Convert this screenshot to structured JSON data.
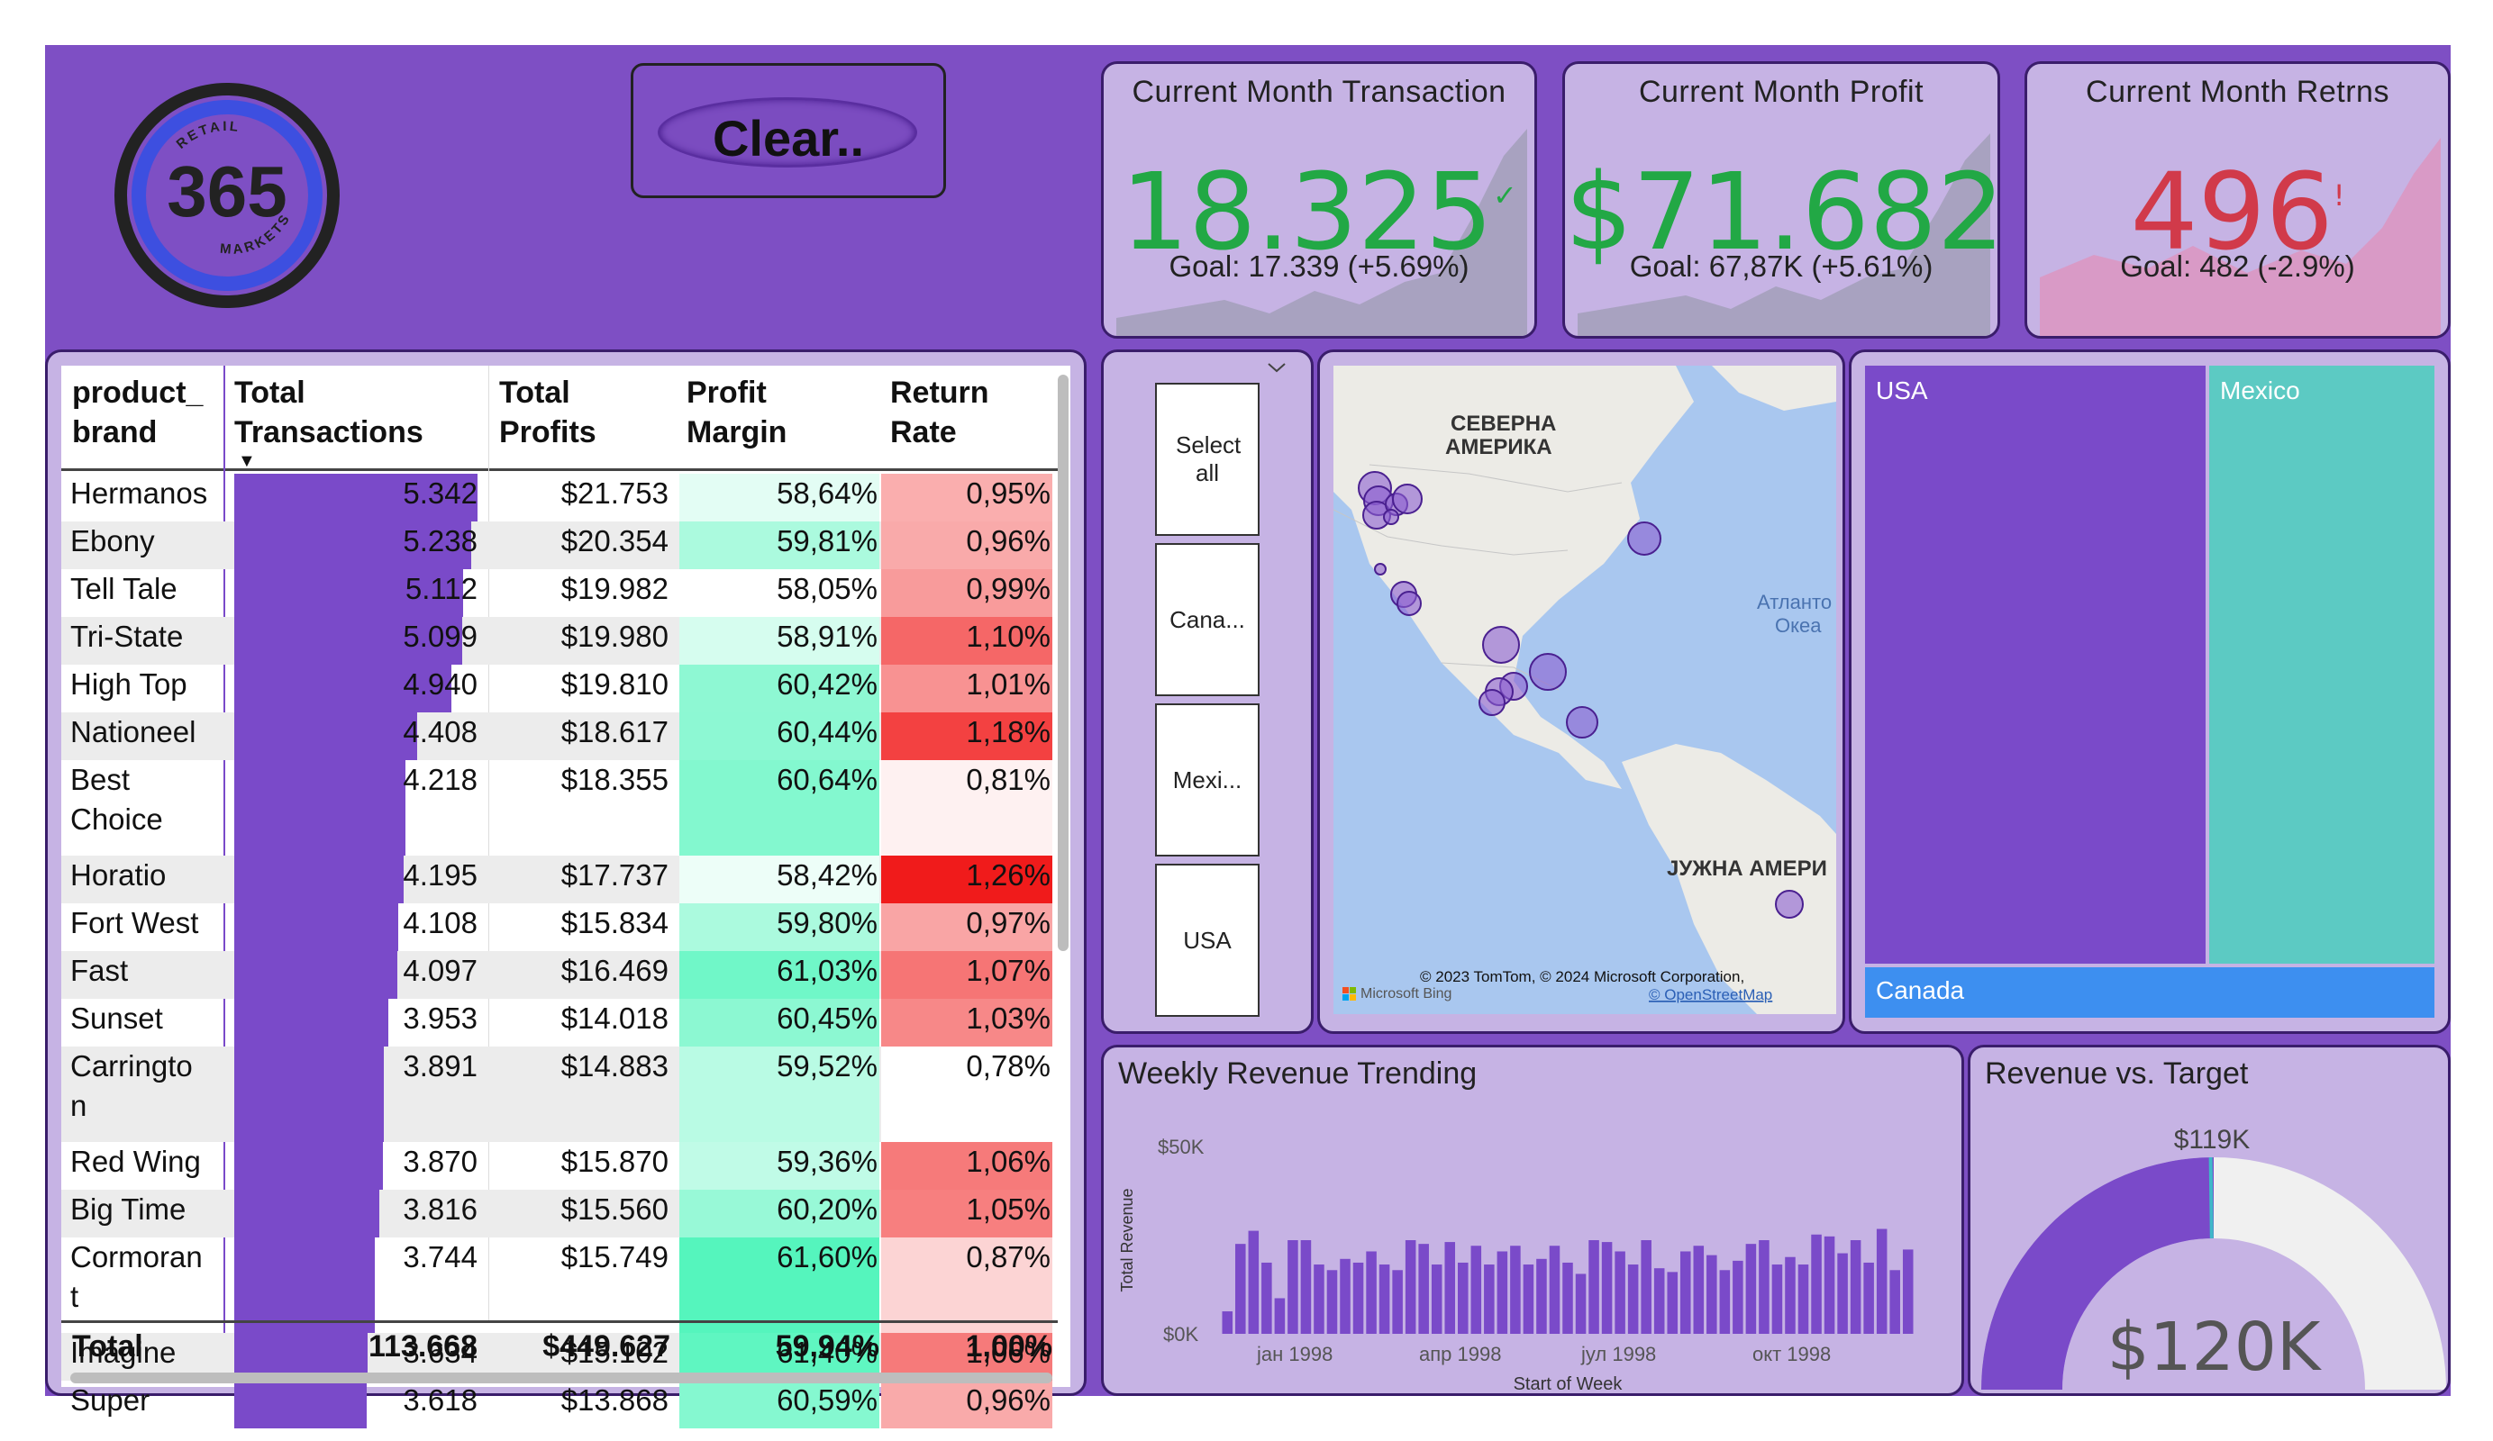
{
  "logo": {
    "text_top": "RETAIL",
    "number": "365",
    "text_bottom": "MARKETS"
  },
  "clear_button": {
    "label": "Clear.."
  },
  "kpis": [
    {
      "title": "Current Month Transaction",
      "value": "18.325",
      "mark": "✓",
      "goal": "Goal: 17.339 (+5.69%)",
      "color": "#22a845"
    },
    {
      "title": "Current Month Profit",
      "value": "$71.682",
      "mark": "✓",
      "goal": "Goal: 67,87K (+5.61%)",
      "color": "#22a845"
    },
    {
      "title": "Current Month Retrns",
      "value": "496",
      "mark": "!",
      "goal": "Goal: 482 (-2.9%)",
      "color": "#d13a4a"
    }
  ],
  "table": {
    "headers": {
      "brand": [
        "product_",
        "brand"
      ],
      "transactions": [
        "Total",
        "Transactions"
      ],
      "profits": [
        "Total",
        "Profits"
      ],
      "margin": [
        "Profit",
        "Margin"
      ],
      "return": [
        "Return",
        "Rate"
      ]
    },
    "sort_indicator": "▼",
    "rows": [
      {
        "brand": [
          "Hermanos"
        ],
        "transactions": 5342,
        "transactions_label": "5.342",
        "profits": "$21.753",
        "margin": "58,64%",
        "margin_value": 58.64,
        "return": "0,95%",
        "return_value": 0.95
      },
      {
        "brand": [
          "Ebony"
        ],
        "transactions": 5238,
        "transactions_label": "5.238",
        "profits": "$20.354",
        "margin": "59,81%",
        "margin_value": 59.81,
        "return": "0,96%",
        "return_value": 0.96
      },
      {
        "brand": [
          "Tell Tale"
        ],
        "transactions": 5112,
        "transactions_label": "5.112",
        "profits": "$19.982",
        "margin": "58,05%",
        "margin_value": 58.05,
        "return": "0,99%",
        "return_value": 0.99
      },
      {
        "brand": [
          "Tri-State"
        ],
        "transactions": 5099,
        "transactions_label": "5.099",
        "profits": "$19.980",
        "margin": "58,91%",
        "margin_value": 58.91,
        "return": "1,10%",
        "return_value": 1.1
      },
      {
        "brand": [
          "High Top"
        ],
        "transactions": 4940,
        "transactions_label": "4.940",
        "profits": "$19.810",
        "margin": "60,42%",
        "margin_value": 60.42,
        "return": "1,01%",
        "return_value": 1.01
      },
      {
        "brand": [
          "Nationeel"
        ],
        "transactions": 4408,
        "transactions_label": "4.408",
        "profits": "$18.617",
        "margin": "60,44%",
        "margin_value": 60.44,
        "return": "1,18%",
        "return_value": 1.18
      },
      {
        "brand": [
          "Best",
          "Choice"
        ],
        "transactions": 4218,
        "transactions_label": "4.218",
        "profits": "$18.355",
        "margin": "60,64%",
        "margin_value": 60.64,
        "return": "0,81%",
        "return_value": 0.81
      },
      {
        "brand": [
          "Horatio"
        ],
        "transactions": 4195,
        "transactions_label": "4.195",
        "profits": "$17.737",
        "margin": "58,42%",
        "margin_value": 58.42,
        "return": "1,26%",
        "return_value": 1.26
      },
      {
        "brand": [
          "Fort West"
        ],
        "transactions": 4108,
        "transactions_label": "4.108",
        "profits": "$15.834",
        "margin": "59,80%",
        "margin_value": 59.8,
        "return": "0,97%",
        "return_value": 0.97
      },
      {
        "brand": [
          "Fast"
        ],
        "transactions": 4097,
        "transactions_label": "4.097",
        "profits": "$16.469",
        "margin": "61,03%",
        "margin_value": 61.03,
        "return": "1,07%",
        "return_value": 1.07
      },
      {
        "brand": [
          "Sunset"
        ],
        "transactions": 3953,
        "transactions_label": "3.953",
        "profits": "$14.018",
        "margin": "60,45%",
        "margin_value": 60.45,
        "return": "1,03%",
        "return_value": 1.03
      },
      {
        "brand": [
          "Carringto",
          "n"
        ],
        "transactions": 3891,
        "transactions_label": "3.891",
        "profits": "$14.883",
        "margin": "59,52%",
        "margin_value": 59.52,
        "return": "0,78%",
        "return_value": 0.78
      },
      {
        "brand": [
          "Red Wing"
        ],
        "transactions": 3870,
        "transactions_label": "3.870",
        "profits": "$15.870",
        "margin": "59,36%",
        "margin_value": 59.36,
        "return": "1,06%",
        "return_value": 1.06
      },
      {
        "brand": [
          "Big Time"
        ],
        "transactions": 3816,
        "transactions_label": "3.816",
        "profits": "$15.560",
        "margin": "60,20%",
        "margin_value": 60.2,
        "return": "1,05%",
        "return_value": 1.05
      },
      {
        "brand": [
          "Cormoran",
          "t"
        ],
        "transactions": 3744,
        "transactions_label": "3.744",
        "profits": "$15.749",
        "margin": "61,60%",
        "margin_value": 61.6,
        "return": "0,87%",
        "return_value": 0.87
      },
      {
        "brand": [
          "Imagine"
        ],
        "transactions": 3634,
        "transactions_label": "3.634",
        "profits": "$15.102",
        "margin": "61,40%",
        "margin_value": 61.4,
        "return": "1,06%",
        "return_value": 1.06
      },
      {
        "brand": [
          "Super"
        ],
        "transactions": 3618,
        "transactions_label": "3.618",
        "profits": "$13.868",
        "margin": "60,59%",
        "margin_value": 60.59,
        "return": "0,96%",
        "return_value": 0.96
      }
    ],
    "totals": {
      "label": "Total",
      "transactions": "113.668",
      "profits": "$449.627",
      "margin": "59,94%",
      "return": "1,00%"
    }
  },
  "slicer": {
    "chevron_icon": "chevron-down-icon",
    "items": [
      "Select all",
      "Cana...",
      "Mexi...",
      "USA"
    ]
  },
  "map": {
    "labels": {
      "north_america": [
        "СЕВЕРНА",
        "АМЕРИКА"
      ],
      "south_america": "ЈУЖНА АМЕРИ",
      "ocean": [
        "Атланто",
        "Океа"
      ]
    },
    "copyright": "© 2023 TomTom, © 2024 Microsoft Corporation,",
    "osm": "© OpenStreetMap",
    "bing": "Microsoft Bing",
    "bubble_color": "#8c5fd0"
  },
  "treemap": {
    "items": [
      "USA",
      "Mexico",
      "Canada"
    ],
    "colors": {
      "USA": "#7a4ac9",
      "Mexico": "#5ccac3",
      "Canada": "#3d8ff0"
    }
  },
  "weekly": {
    "title": "Weekly Revenue Trending",
    "chart_data": {
      "type": "bar",
      "title": "Weekly Revenue Trending",
      "xlabel": "Start of Week",
      "ylabel": "Total Revenue",
      "y_ticks": [
        "$50K",
        "$0K"
      ],
      "x_ticks": [
        "јан 1998",
        "апр 1998",
        "јул 1998",
        "окт 1998"
      ],
      "ylim": [
        0,
        50000
      ],
      "values": [
        6000,
        24000,
        27500,
        19000,
        9500,
        25000,
        25000,
        18500,
        17000,
        20000,
        19000,
        22000,
        18500,
        17000,
        25000,
        24000,
        18500,
        24500,
        19000,
        23500,
        18500,
        22000,
        23500,
        18500,
        20000,
        23500,
        19000,
        16000,
        25000,
        24500,
        22000,
        18500,
        25000,
        17500,
        16500,
        22000,
        23500,
        21000,
        17000,
        19500,
        24000,
        25000,
        18500,
        20500,
        18500,
        26500,
        26000,
        21500,
        25000,
        19000,
        28000,
        17000,
        22500
      ]
    },
    "bar_color": "#7a4ac9"
  },
  "gauge": {
    "title": "Revenue vs. Target",
    "target_label": "$119K",
    "value_label": "$120K",
    "chart_data": {
      "type": "gauge",
      "value": 120,
      "target": 119,
      "max": 240,
      "unit": "K"
    },
    "fill_color": "#7a4ac9",
    "track_color": "#f0f0f0",
    "target_color": "#3fb8c8"
  }
}
